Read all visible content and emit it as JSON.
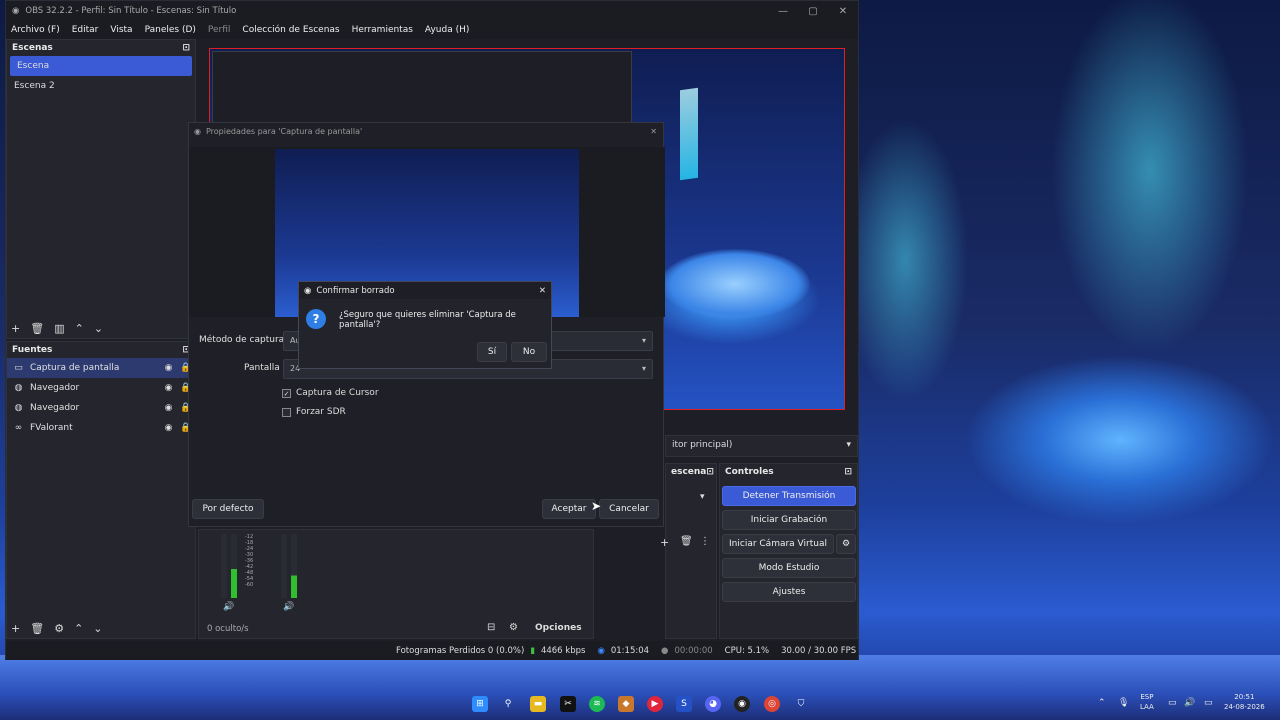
{
  "window": {
    "title": "OBS 32.2.2 - Perfil: Sin Título - Escenas: Sin Título",
    "controls": [
      "—",
      "▢",
      "✕"
    ]
  },
  "menu": [
    "Archivo (F)",
    "Editar",
    "Vista",
    "Paneles (D)",
    "Perfil",
    "Colección de Escenas",
    "Herramientas",
    "Ayuda (H)"
  ],
  "scenes": {
    "title": "Escenas",
    "items": [
      "Escena",
      "Escena 2"
    ]
  },
  "sources": {
    "title": "Fuentes",
    "items": [
      "Captura de pantalla",
      "Navegador",
      "Navegador",
      "FValorant"
    ]
  },
  "properties_dialog": {
    "title": "Propiedades para 'Captura de pantalla'",
    "capture_method_label": "Método de captura",
    "capture_method_value": "Au",
    "screen_label": "Pantalla",
    "screen_value": "24",
    "checkbox_cursor": "Captura de Cursor",
    "checkbox_sdr": "Forzar SDR",
    "defaults_button": "Por defecto",
    "accept_button": "Aceptar",
    "cancel_button": "Cancelar"
  },
  "confirm_dialog": {
    "title": "Confirmar borrado",
    "message": "¿Seguro que quieres eliminar 'Captura de pantalla'?",
    "yes": "Sí",
    "no": "No"
  },
  "transition_combo": "itor principal)",
  "scene_transitions_title": "escena",
  "controls": {
    "title": "Controles",
    "buttons": [
      "Detener Transmisión",
      "Iniciar Grabación",
      "Iniciar Cámara Virtual",
      "Modo Estudio",
      "Ajustes"
    ]
  },
  "mixer": {
    "ticks": [
      "-12",
      "-18",
      "-24",
      "-30",
      "-36",
      "-42",
      "-48",
      "-54",
      "-60"
    ],
    "hidden_label": "0 oculto/s",
    "options_label": "Opciones"
  },
  "status": {
    "frames": "Fotogramas Perdidos 0 (0.0%)",
    "bitrate": "4466 kbps",
    "stream_time": "01:15:04",
    "rec_time": "00:00:00",
    "cpu": "CPU: 5.1%",
    "fps": "30.00 / 30.00 FPS"
  },
  "tray": {
    "lang": "ESP",
    "lang2": "LAA",
    "time": "20:51",
    "date": "24-08-2026"
  },
  "colors": {
    "accent": "#3b5bd6",
    "preview_border": "#e02020"
  }
}
